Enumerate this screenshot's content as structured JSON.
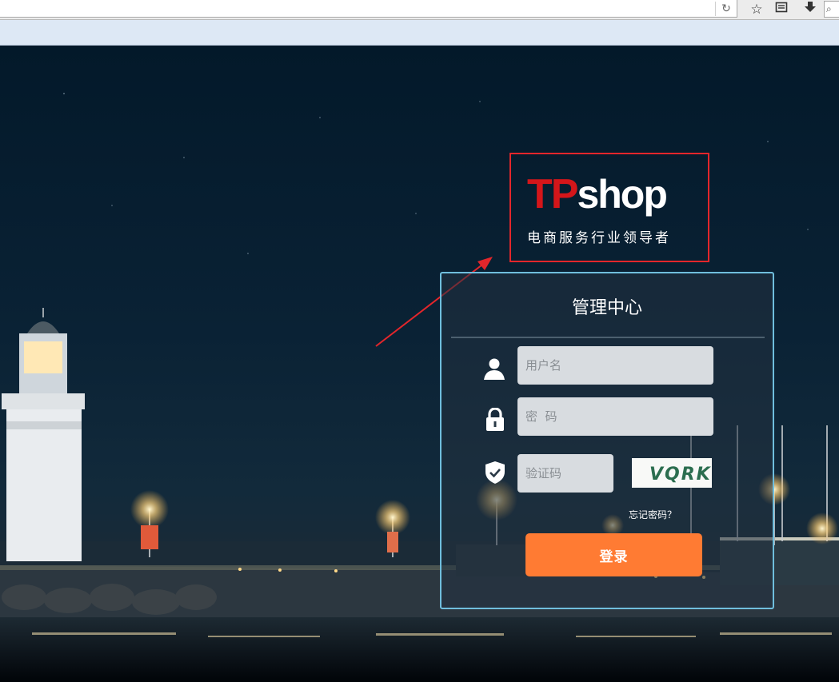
{
  "browser": {
    "reload_icon": "reload-icon",
    "bookmark_icon": "star-icon",
    "reading_list_icon": "reading-list-icon",
    "download_icon": "download-icon",
    "search_icon": "search-icon"
  },
  "logo": {
    "brand_tp": "TP",
    "brand_shop": "shop",
    "slogan": "电商服务行业领导者"
  },
  "login": {
    "title": "管理中心",
    "username_placeholder": "用户名",
    "password_placeholder": "密  码",
    "captcha_placeholder": "验证码",
    "captcha_text": "VQRK",
    "forgot_link": "忘记密码？",
    "submit_label": "登录"
  },
  "colors": {
    "panel_border": "#6fbedd",
    "button": "#ff7b33",
    "annotation_red": "#e3262b",
    "logo_red": "#d4161a"
  }
}
